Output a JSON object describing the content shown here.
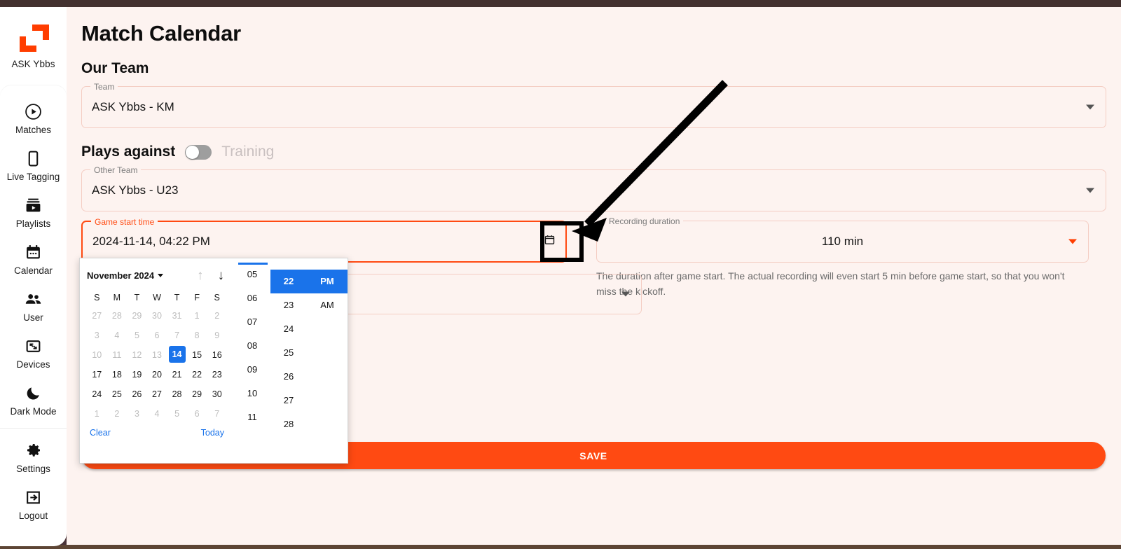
{
  "sidebar": {
    "brand": "ASK Ybbs",
    "logo_icon": "brand-logo-icon",
    "items": [
      {
        "label": "Matches",
        "icon": "play-circle-icon"
      },
      {
        "label": "Live Tagging",
        "icon": "phone-icon"
      },
      {
        "label": "Playlists",
        "icon": "playlist-icon"
      },
      {
        "label": "Calendar",
        "icon": "calendar-icon"
      },
      {
        "label": "User",
        "icon": "people-icon"
      },
      {
        "label": "Devices",
        "icon": "devices-icon"
      },
      {
        "label": "Dark Mode",
        "icon": "moon-icon"
      }
    ],
    "footer_items": [
      {
        "label": "Settings",
        "icon": "gear-icon"
      },
      {
        "label": "Logout",
        "icon": "logout-icon"
      }
    ]
  },
  "page": {
    "title": "Match Calendar",
    "our_team_heading": "Our Team",
    "plays_against_label": "Plays against",
    "training_label": "Training",
    "save_label": "SAVE"
  },
  "fields": {
    "team": {
      "legend": "Team",
      "value": "ASK Ybbs - KM"
    },
    "other_team": {
      "legend": "Other Team",
      "value": "ASK Ybbs - U23"
    },
    "game_start_time": {
      "legend": "Game start time",
      "value": "2024-11-14, 04:22 PM",
      "icon": "calendar-icon"
    },
    "recording_duration": {
      "legend": "Recording duration",
      "value": "110 min",
      "helper": "The duration after game start. The actual recording will even start 5 min before game start, so that you won't miss the kickoff."
    }
  },
  "picker": {
    "month_label": "November 2024",
    "prev_arrow": "arrow-up-icon",
    "next_arrow": "arrow-down-icon",
    "dow": [
      "S",
      "M",
      "T",
      "W",
      "T",
      "F",
      "S"
    ],
    "weeks": [
      [
        {
          "d": "27",
          "muted": true
        },
        {
          "d": "28",
          "muted": true
        },
        {
          "d": "29",
          "muted": true
        },
        {
          "d": "30",
          "muted": true
        },
        {
          "d": "31",
          "muted": true
        },
        {
          "d": "1",
          "muted": true
        },
        {
          "d": "2",
          "muted": true
        }
      ],
      [
        {
          "d": "3",
          "muted": true
        },
        {
          "d": "4",
          "muted": true
        },
        {
          "d": "5",
          "muted": true
        },
        {
          "d": "6",
          "muted": true
        },
        {
          "d": "7",
          "muted": true
        },
        {
          "d": "8",
          "muted": true
        },
        {
          "d": "9",
          "muted": true
        }
      ],
      [
        {
          "d": "10",
          "muted": true
        },
        {
          "d": "11",
          "muted": true
        },
        {
          "d": "12",
          "muted": true
        },
        {
          "d": "13",
          "muted": true
        },
        {
          "d": "14",
          "selected": true
        },
        {
          "d": "15"
        },
        {
          "d": "16"
        }
      ],
      [
        {
          "d": "17"
        },
        {
          "d": "18"
        },
        {
          "d": "19"
        },
        {
          "d": "20"
        },
        {
          "d": "21"
        },
        {
          "d": "22"
        },
        {
          "d": "23"
        }
      ],
      [
        {
          "d": "24"
        },
        {
          "d": "25"
        },
        {
          "d": "26"
        },
        {
          "d": "27"
        },
        {
          "d": "28"
        },
        {
          "d": "29"
        },
        {
          "d": "30"
        }
      ],
      [
        {
          "d": "1",
          "muted": true
        },
        {
          "d": "2",
          "muted": true
        },
        {
          "d": "3",
          "muted": true
        },
        {
          "d": "4",
          "muted": true
        },
        {
          "d": "5",
          "muted": true
        },
        {
          "d": "6",
          "muted": true
        },
        {
          "d": "7",
          "muted": true
        }
      ]
    ],
    "clear_label": "Clear",
    "today_label": "Today",
    "hours": [
      "05",
      "06",
      "07",
      "08",
      "09",
      "10",
      "11"
    ],
    "minutes": [
      "22",
      "23",
      "24",
      "25",
      "26",
      "27",
      "28"
    ],
    "selected_minute": "22",
    "meridiem": [
      "PM",
      "AM"
    ],
    "selected_meridiem": "PM"
  },
  "colors": {
    "accent": "#ff4a12",
    "picker_select": "#1a73ea",
    "surface": "#fdf3f0",
    "sidebar": "#ffffff",
    "topbar": "#43312f"
  },
  "annotation": {
    "highlight_target": "game-start-time-calendar-icon",
    "arrow": "pointer-arrow"
  }
}
